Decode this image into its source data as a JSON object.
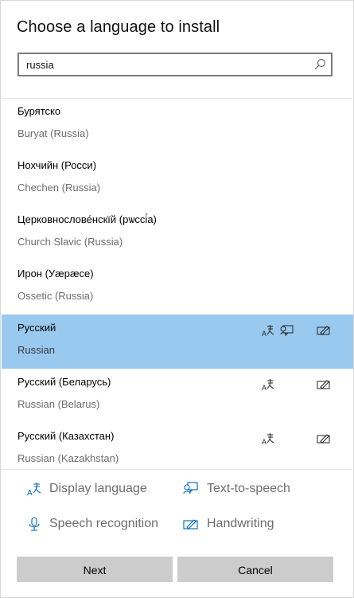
{
  "dialog": {
    "title": "Choose a language to install"
  },
  "search": {
    "value": "russia",
    "icon": "search-icon"
  },
  "languages": [
    {
      "native": "Бурятско",
      "english": "Buryat (Russia)",
      "features": []
    },
    {
      "native": "Нохчийн (Росси)",
      "english": "Chechen (Russia)",
      "features": []
    },
    {
      "native": "Церковнослове́нскїй (рѡссі́а)",
      "english": "Church Slavic (Russia)",
      "features": []
    },
    {
      "native": "Ирон (Уæрæсе)",
      "english": "Ossetic (Russia)",
      "features": []
    },
    {
      "native": "Русский",
      "english": "Russian",
      "features": [
        "display-language",
        "text-to-speech",
        "handwriting"
      ],
      "selected": true
    },
    {
      "native": "Русский (Беларусь)",
      "english": "Russian (Belarus)",
      "features": [
        "display-language",
        "handwriting"
      ]
    },
    {
      "native": "Русский (Казахстан)",
      "english": "Russian (Kazakhstan)",
      "features": [
        "display-language",
        "handwriting"
      ]
    }
  ],
  "legend": {
    "display_language": "Display language",
    "text_to_speech": "Text-to-speech",
    "speech_recognition": "Speech recognition",
    "handwriting": "Handwriting"
  },
  "buttons": {
    "next": "Next",
    "cancel": "Cancel"
  },
  "colors": {
    "selected_row": "#99c9ef",
    "accent_icon": "#0063b1",
    "button_bg": "#cccccc"
  }
}
